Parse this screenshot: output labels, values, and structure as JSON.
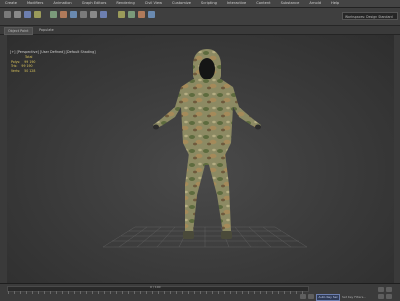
{
  "menus": [
    "Create",
    "Modifiers",
    "Animation",
    "Graph Editors",
    "Rendering",
    "Civil View",
    "Customize",
    "Scripting",
    "Interactive",
    "Content",
    "Substance",
    "Arnold",
    "Help"
  ],
  "workspace": {
    "label": "Workspaces: Design Standard"
  },
  "ribbon": {
    "tabs": [
      "Object Paint",
      "Populate"
    ]
  },
  "viewport": {
    "label": "[+] [Perspective] [User Defined] [Default Shading]",
    "stats": {
      "title": "Total",
      "rows": [
        {
          "label": "Polys:",
          "value": "99 190"
        },
        {
          "label": "Tris:",
          "value": "99 190"
        },
        {
          "label": "Verts:",
          "value": "50 128"
        }
      ]
    }
  },
  "status": {
    "frame_label": "0 / 100",
    "key_button": "Auto Key Sel",
    "set_key": "Set Key Filters..."
  },
  "colors": {
    "accent": "#6d7fb0",
    "stats_yellow": "#d9c35a"
  },
  "icons": [
    "undo-icon",
    "redo-icon",
    "link-icon",
    "unlink-icon",
    "select-icon",
    "move-icon",
    "rotate-icon",
    "scale-icon",
    "snap-icon",
    "mirror-icon",
    "align-icon",
    "render-icon",
    "material-editor-icon",
    "render-setup-icon"
  ]
}
